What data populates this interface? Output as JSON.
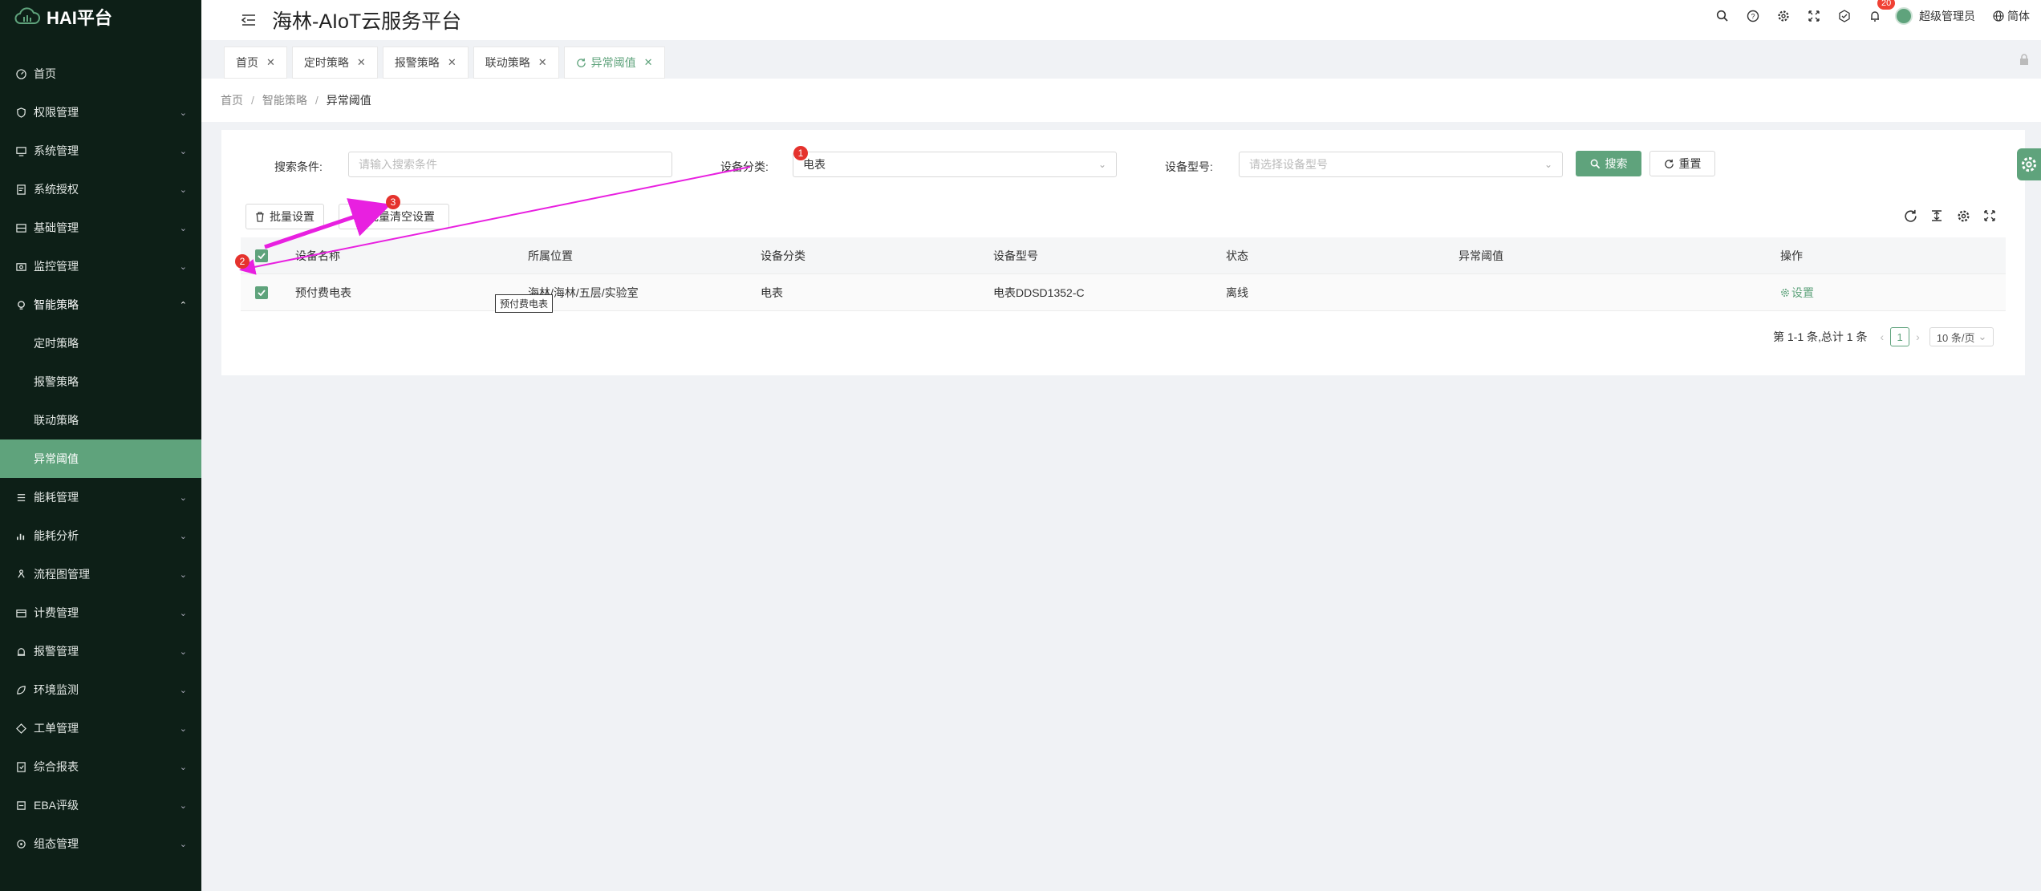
{
  "sidebar": {
    "logo_text": "HAI平台",
    "items": [
      {
        "label": "首页",
        "icon": "dashboard-icon"
      },
      {
        "label": "权限管理",
        "icon": "shield-icon"
      },
      {
        "label": "系统管理",
        "icon": "monitor-icon"
      },
      {
        "label": "系统授权",
        "icon": "license-icon"
      },
      {
        "label": "基础管理",
        "icon": "server-icon"
      },
      {
        "label": "监控管理",
        "icon": "camera-icon"
      },
      {
        "label": "智能策略",
        "icon": "bulb-icon"
      },
      {
        "label": "定时策略"
      },
      {
        "label": "报警策略"
      },
      {
        "label": "联动策略"
      },
      {
        "label": "异常阈值"
      },
      {
        "label": "能耗管理",
        "icon": "list-icon"
      },
      {
        "label": "能耗分析",
        "icon": "bar-chart-icon"
      },
      {
        "label": "流程图管理",
        "icon": "flow-icon"
      },
      {
        "label": "计费管理",
        "icon": "billing-icon"
      },
      {
        "label": "报警管理",
        "icon": "alarm-icon"
      },
      {
        "label": "环境监测",
        "icon": "leaf-icon"
      },
      {
        "label": "工单管理",
        "icon": "ticket-icon"
      },
      {
        "label": "综合报表",
        "icon": "report-icon"
      },
      {
        "label": "EBA评级",
        "icon": "rating-icon"
      },
      {
        "label": "组态管理",
        "icon": "config-icon"
      }
    ]
  },
  "header": {
    "title": "海林-AIoT云服务平台",
    "notification_count": "20",
    "user_name": "超级管理员",
    "language": "简体"
  },
  "tabs": [
    {
      "label": "首页"
    },
    {
      "label": "定时策略"
    },
    {
      "label": "报警策略"
    },
    {
      "label": "联动策略"
    },
    {
      "label": "异常阈值"
    }
  ],
  "breadcrumb": [
    "首页",
    "智能策略",
    "异常阈值"
  ],
  "search": {
    "condition_label": "搜索条件:",
    "condition_placeholder": "请输入搜索条件",
    "category_label": "设备分类:",
    "category_value": "电表",
    "model_label": "设备型号:",
    "model_placeholder": "请选择设备型号",
    "search_button": "搜索",
    "reset_button": "重置"
  },
  "toolbar": {
    "batch_set": "批量设置",
    "batch_clear": "批量清空设置"
  },
  "table": {
    "columns": [
      "设备名称",
      "所属位置",
      "设备分类",
      "设备型号",
      "状态",
      "异常阈值",
      "操作"
    ],
    "rows": [
      {
        "name": "预付费电表",
        "location": "海林/海林/五层/实验室",
        "category": "电表",
        "model": "电表DDSD1352-C",
        "status": "离线",
        "threshold": "",
        "action": "设置"
      }
    ],
    "tooltip": "预付费电表"
  },
  "pagination": {
    "summary": "第 1-1 条,总计 1 条",
    "current_page": "1",
    "page_size": "10 条/页"
  },
  "annotations": {
    "marker1": "1",
    "marker2": "2",
    "marker3": "3",
    "arrow_color": "#e820e0"
  }
}
